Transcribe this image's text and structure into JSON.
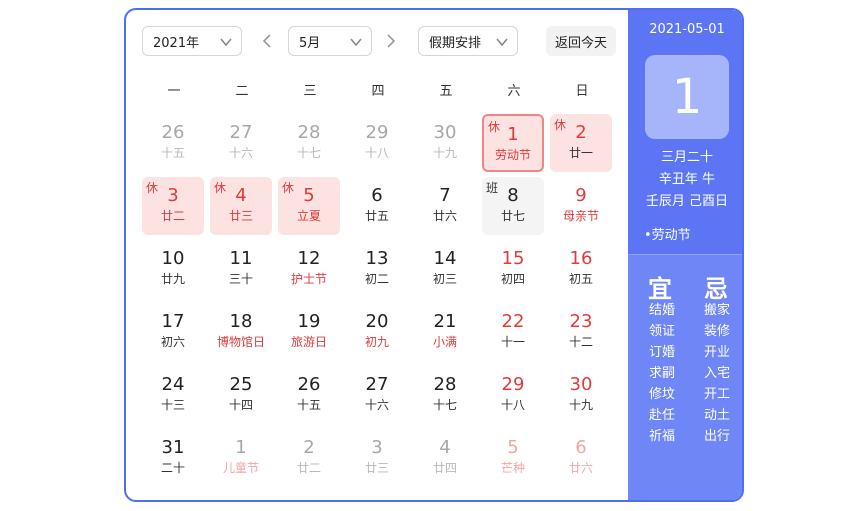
{
  "toolbar": {
    "year": "2021年",
    "month": "5月",
    "holiday": "假期安排",
    "today": "返回今天"
  },
  "weekdays": [
    "一",
    "二",
    "三",
    "四",
    "五",
    "六",
    "日"
  ],
  "weeks": [
    [
      {
        "num": "26",
        "lun": "十五",
        "other": true
      },
      {
        "num": "27",
        "lun": "十六",
        "other": true
      },
      {
        "num": "28",
        "lun": "十七",
        "other": true
      },
      {
        "num": "29",
        "lun": "十八",
        "other": true
      },
      {
        "num": "30",
        "lun": "十九",
        "other": true
      },
      {
        "num": "1",
        "lun": "劳动节",
        "tag": "休",
        "rest": true,
        "red": true,
        "festival": true,
        "selected": true
      },
      {
        "num": "2",
        "lun": "廿一",
        "tag": "休",
        "rest": true,
        "red": true
      }
    ],
    [
      {
        "num": "3",
        "lun": "廿二",
        "tag": "休",
        "rest": true,
        "red": true,
        "festival": true
      },
      {
        "num": "4",
        "lun": "廿三",
        "tag": "休",
        "rest": true,
        "red": true,
        "festival": true
      },
      {
        "num": "5",
        "lun": "立夏",
        "tag": "休",
        "rest": true,
        "red": true,
        "festival": true
      },
      {
        "num": "6",
        "lun": "廿五"
      },
      {
        "num": "7",
        "lun": "廿六"
      },
      {
        "num": "8",
        "lun": "廿七",
        "tag": "班",
        "work": true
      },
      {
        "num": "9",
        "lun": "母亲节",
        "red": true,
        "festival": true
      }
    ],
    [
      {
        "num": "10",
        "lun": "廿九"
      },
      {
        "num": "11",
        "lun": "三十"
      },
      {
        "num": "12",
        "lun": "护士节",
        "festival": true
      },
      {
        "num": "13",
        "lun": "初二"
      },
      {
        "num": "14",
        "lun": "初三"
      },
      {
        "num": "15",
        "lun": "初四",
        "red": true
      },
      {
        "num": "16",
        "lun": "初五",
        "red": true
      }
    ],
    [
      {
        "num": "17",
        "lun": "初六"
      },
      {
        "num": "18",
        "lun": "博物馆日",
        "festival": true
      },
      {
        "num": "19",
        "lun": "旅游日",
        "festival": true
      },
      {
        "num": "20",
        "lun": "初九",
        "festival": true
      },
      {
        "num": "21",
        "lun": "小满",
        "festival": true
      },
      {
        "num": "22",
        "lun": "十一",
        "red": true
      },
      {
        "num": "23",
        "lun": "十二",
        "red": true
      }
    ],
    [
      {
        "num": "24",
        "lun": "十三"
      },
      {
        "num": "25",
        "lun": "十四"
      },
      {
        "num": "26",
        "lun": "十五"
      },
      {
        "num": "27",
        "lun": "十六"
      },
      {
        "num": "28",
        "lun": "十七"
      },
      {
        "num": "29",
        "lun": "十八",
        "red": true
      },
      {
        "num": "30",
        "lun": "十九",
        "red": true
      }
    ],
    [
      {
        "num": "31",
        "lun": "二十"
      },
      {
        "num": "1",
        "lun": "儿童节",
        "other": true,
        "festival": true
      },
      {
        "num": "2",
        "lun": "廿二",
        "other": true
      },
      {
        "num": "3",
        "lun": "廿三",
        "other": true
      },
      {
        "num": "4",
        "lun": "廿四",
        "other": true
      },
      {
        "num": "5",
        "lun": "芒种",
        "other": true,
        "red": true,
        "festival": true
      },
      {
        "num": "6",
        "lun": "廿六",
        "other": true,
        "red": true,
        "redl": true
      }
    ]
  ],
  "side": {
    "date": "2021-05-01",
    "day": "1",
    "lunar": "三月二十",
    "ganzhi_year": "辛丑年 牛",
    "ganzhi_day": "壬辰月 己酉日",
    "festival": "•劳动节",
    "yi_head": "宜",
    "ji_head": "忌",
    "yi": [
      "结婚",
      "领证",
      "订婚",
      "求嗣",
      "修坟",
      "赴任",
      "祈福"
    ],
    "ji": [
      "搬家",
      "装修",
      "开业",
      "入宅",
      "开工",
      "动土",
      "出行"
    ]
  },
  "colors": {
    "accent": "#4e6ef2",
    "side_top": "#5b75f4",
    "side_bottom": "#6f86f6",
    "holiday_red": "#e03b3b",
    "rest_bg": "#fde2e2"
  }
}
